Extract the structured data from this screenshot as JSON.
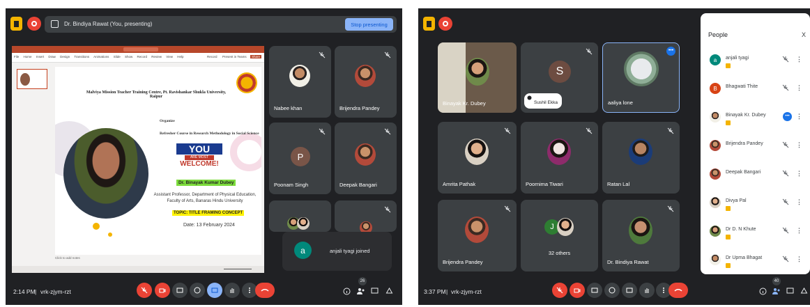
{
  "left": {
    "presenting_label": "Dr. Bindiya Rawat (You, presenting)",
    "stop_button": "Stop presenting",
    "time": "2:14 PM",
    "separator": "|",
    "meeting_code": "vrk-zjym-rzt",
    "participant_count": "26",
    "slide": {
      "institution": "Malviya Mission Teacher Training Centre, Pt. Ravishankar Shukla University, Raipur",
      "organize": "Organize",
      "course": "Refresher Course in Research Methodology in Social Science",
      "you": "YOU",
      "are_most": "ARE MOST",
      "welcome": "WELCOME!",
      "speaker": "Dr. Binayak Kumar Dubey",
      "designation": "Assistant Professor, Department of Physical Education, Faculty of Arts, Banaras Hindu University",
      "topic": "TOPIC: TITLE FRAMING CONCEPT",
      "date": "Date: 13 February 2024",
      "notes_hint": "Click to add notes",
      "menu": [
        "File",
        "Home",
        "Insert",
        "Draw",
        "Design",
        "Transitions",
        "Animations",
        "Slide Show",
        "Record",
        "Review",
        "View",
        "Help"
      ],
      "record_btn": "Record",
      "present_btn": "Present in Teams",
      "share_btn": "Share"
    },
    "tiles": [
      {
        "name": "Nabee khan"
      },
      {
        "name": "Brijendra Pandey"
      },
      {
        "name": "Poonam Singh",
        "initial": "P",
        "color": "#795548"
      },
      {
        "name": "Deepak Bangari"
      }
    ],
    "toast": {
      "initial": "a",
      "text": "anjali tyagi joined",
      "color": "#00897b"
    }
  },
  "right": {
    "time": "3:37 PM",
    "separator": "|",
    "meeting_code": "vrk-zjym-rzt",
    "participant_count": "40",
    "tiles": [
      {
        "name": "Binayak Kr. Dubey"
      },
      {
        "name": "Sushil Ekka",
        "initial": "S",
        "color": "#6d4c41"
      },
      {
        "name": "aaliya lone"
      },
      {
        "name": "Amrita Pathak"
      },
      {
        "name": "Poornima Tiwari"
      },
      {
        "name": "Ratan Lal"
      },
      {
        "name": "Brijendra Pandey"
      },
      {
        "name": "32 others",
        "initial": "J",
        "color": "#2e7d32"
      },
      {
        "name": "Dr. Bindiya Rawat"
      }
    ],
    "people": {
      "title": "People",
      "close": "X",
      "list": [
        {
          "name": "anjali tyagi",
          "initial": "a",
          "color": "#00897b"
        },
        {
          "name": "Bhagwati Thite",
          "initial": "B",
          "color": "#d84315"
        },
        {
          "name": "Binayak Kr. Dubey",
          "initial": "",
          "color": "#8d6e63"
        },
        {
          "name": "Brijendra Pandey",
          "initial": "",
          "color": "#a0522d"
        },
        {
          "name": "Deepak Bangari",
          "initial": "",
          "color": "#c0392b"
        },
        {
          "name": "Divya Pal",
          "initial": "",
          "color": "#a1887f"
        },
        {
          "name": "Dr D. N Khute",
          "initial": "",
          "color": "#5d4037"
        },
        {
          "name": "Dr Upma Bhagat",
          "initial": "",
          "color": "#e0e0e0"
        }
      ]
    }
  }
}
